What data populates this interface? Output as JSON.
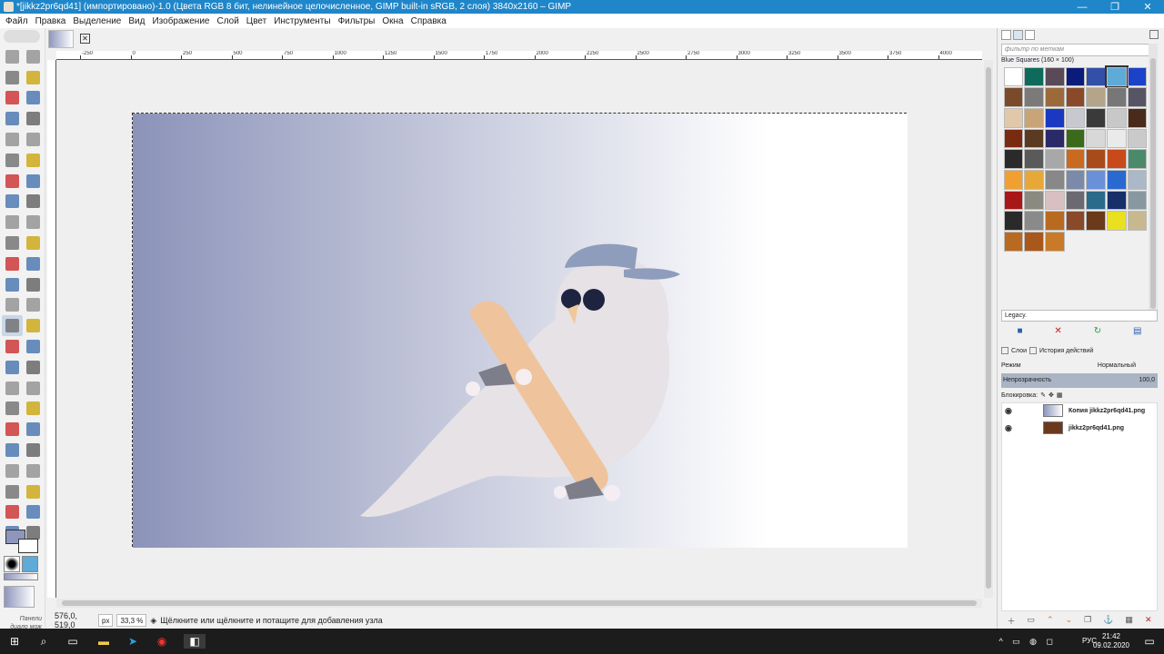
{
  "window": {
    "title": "*[jikkz2pr6qd41] (импортировано)-1.0 (Цвета RGB 8 бит, нелинейное целочисленное, GIMP built-in sRGB, 2 слоя) 3840x2160 – GIMP",
    "minimize": "—",
    "maximize": "❐",
    "close": "✕"
  },
  "menu": [
    "Файл",
    "Правка",
    "Выделение",
    "Вид",
    "Изображение",
    "Слой",
    "Цвет",
    "Инструменты",
    "Фильтры",
    "Окна",
    "Справка"
  ],
  "toolbox": {
    "dock_hint": "Пане­ли\nдиало\nмож\nприкре\nсюд.",
    "tools": [
      "rect-select",
      "ellipse-select",
      "free-select",
      "fuzzy-select",
      "select-by-color",
      "scissors-select",
      "foreground-select",
      "paths",
      "color-picker",
      "zoom",
      "measure",
      "move",
      "align",
      "crop",
      "unified-transform",
      "rotate",
      "scale",
      "shear",
      "flip",
      "perspective",
      "3d-transform",
      "warp-transform",
      "handle-transform",
      "cage-transform",
      "text",
      "bucket-fill",
      "gradient",
      "paintbrush",
      "pencil",
      "airbrush",
      "ink",
      "mypaint-brush",
      "clone",
      "heal",
      "perspective-clone",
      "blur",
      "smudge",
      "dodge-burn",
      "desaturate",
      "levels",
      "curves",
      "color-balance",
      "hue-saturation",
      "threshold",
      "brightness-contrast",
      "filter",
      "gegl",
      "circle"
    ],
    "selected_tool": "gradient"
  },
  "canvas": {
    "rulers": [
      "-250",
      "0",
      "250",
      "500",
      "750",
      "1000",
      "1250",
      "1500",
      "1750",
      "2000",
      "2250",
      "2500",
      "2750",
      "3000",
      "3250",
      "3500",
      "3750",
      "4000"
    ],
    "gradient_start": "#8c93b9",
    "gradient_end": "#ffffff"
  },
  "status": {
    "coords": "576,0, 519,0",
    "unit": "px",
    "zoom": "33,3 %",
    "message": "Щёлкните или щёлкните и потащите для добавления узла"
  },
  "patterns": {
    "filter_placeholder": "фильтр по меткам",
    "name": "Blue Squares (160 × 100)",
    "legacy": "Legacy.",
    "colors": [
      "#ffffff",
      "#0e6b5c",
      "#5a4a58",
      "#0b1b7a",
      "#3350a8",
      "#5eaad8",
      "#1b42c8",
      "#7a4a2a",
      "#7b7a78",
      "#9c6a3a",
      "#8a4a2a",
      "#b4a48a",
      "#777",
      "#556",
      "#e0c8a8",
      "#c8a478",
      "#1b38c0",
      "#c8c8d0",
      "#3a3a3a",
      "#c8c8c8",
      "#4a2a1a",
      "#7a2a10",
      "#5a3a20",
      "#2a2a68",
      "#3a6a1a",
      "#d8d8d8",
      "#eaeaea",
      "#cacaca",
      "#2a2a2a",
      "#5a5a5a",
      "#a8a8a8",
      "#c86a20",
      "#a84a1a",
      "#c84a1a",
      "#4a8a6a",
      "#f0a030",
      "#e8a838",
      "#888",
      "#7a8aa8",
      "#6a90d8",
      "#2a6ad0",
      "#aab8c8",
      "#a81818",
      "#8a8a80",
      "#d8c0c0",
      "#6a6a70",
      "#2a6a8a",
      "#18306a",
      "#8898a0",
      "#2a2a2a",
      "#8a8a8a",
      "#b86a20",
      "#8a4a2a",
      "#6a3a1a",
      "#e8e020",
      "#c8b890",
      "#b86a20",
      "#a8581a",
      "#c87a28"
    ],
    "selected_index": 5
  },
  "layers": {
    "tabs": [
      "Слои",
      "История действий"
    ],
    "mode_label": "Режим",
    "mode_value": "Нормальный",
    "opacity_label": "Непрозрачность",
    "opacity_value": "100,0",
    "lock_label": "Блокировка:",
    "items": [
      {
        "name": "Копия jikkz2pr6qd41.png",
        "thumb": "gradient"
      },
      {
        "name": "jikkz2pr6qd41.png",
        "thumb": "bird"
      }
    ]
  },
  "taskbar": {
    "time": "21:42",
    "date": "09.02.2020",
    "lang": "РУС",
    "tray": "^ ▭ ◍ ◻"
  }
}
